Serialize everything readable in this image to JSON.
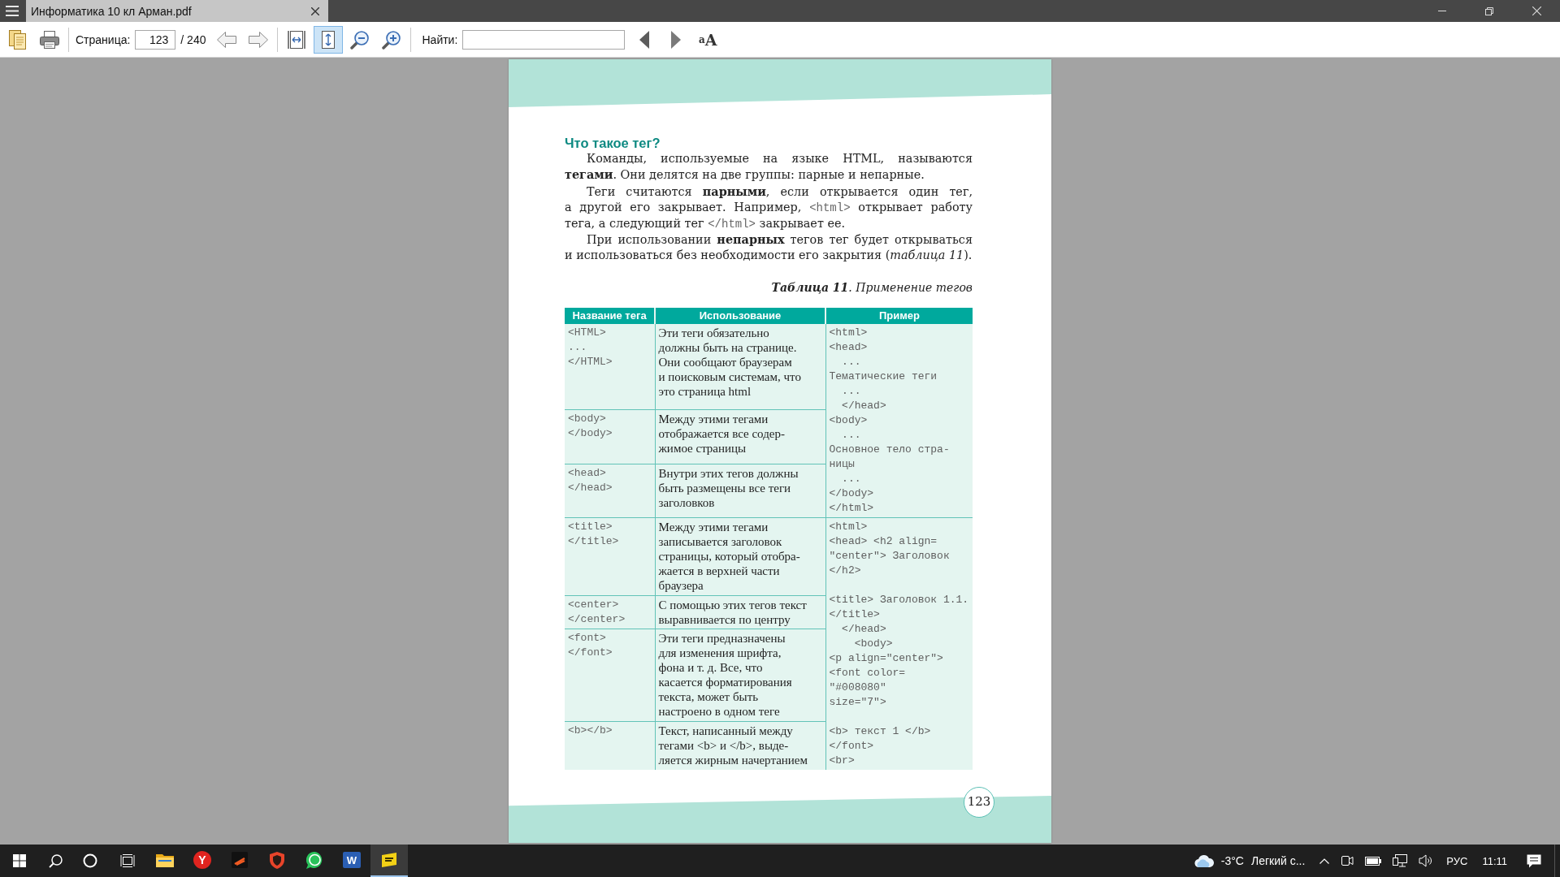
{
  "window": {
    "tab_title": "Информатика 10 кл Арман.pdf"
  },
  "toolbar": {
    "page_label": "Страница:",
    "page_value": "123",
    "page_total": "/ 240",
    "view_modes": [
      {
        "kind": "fit_width",
        "selected": false
      },
      {
        "kind": "fit_page",
        "selected": true
      }
    ],
    "find_label": "Найти:",
    "match_case_label": "$^{a}$A"
  },
  "page": {
    "heading": "Что такое тег?",
    "paragraphs": [
      {
        "segments": [
          {
            "kind": "text",
            "text": "Команды, используемые на языке HTML, называются\n**тегами**. Они делятся на две группы: парные и непарные."
          }
        ]
      },
      {
        "segments": [
          {
            "kind": "text",
            "text": "Теги считаются **парными**, если открывается один тег,\nа другой его закрывает. Например, "
          },
          {
            "kind": "code",
            "text": "<html>"
          },
          {
            "kind": "text",
            "text": " открывает работу\nтега, а следующий тег "
          },
          {
            "kind": "code",
            "text": "</html>"
          },
          {
            "kind": "text",
            "text": " закрывает ее."
          }
        ]
      },
      {
        "segments": [
          {
            "kind": "text",
            "text": "При использовании **непарных** тегов тег будет открываться\nи использоваться без необходимости его закрытия (*таблица 11*)."
          }
        ]
      }
    ],
    "caption": "**Таблица 11**. Применение тегов",
    "table": {
      "columns": [
        "Название тега",
        "Использование",
        "Пример"
      ],
      "groups": [
        {
          "rows": [
            {
              "tag": "<HTML>\n...\n</HTML>",
              "usage": "Эти теги обязательно\nдолжны быть на странице.\nОни сообщают браузерам\nи поисковым системам, что\nэто страница html"
            },
            {
              "tag": "<body>\n</body>",
              "usage": "Между этими тегами\nотображается все содер-\nжимое страницы"
            },
            {
              "tag": "<head>\n</head>",
              "usage": "Внутри этих тегов должны\nбыть размещены все теги\nзаголовков"
            }
          ],
          "example": "<html>\n<head>\n  ...\nТематические теги\n  ...\n  </head>\n<body>\n  ...\nОсновное тело стра-\nницы\n  ...\n</body>\n</html>"
        },
        {
          "rows": [
            {
              "tag": "<title>\n</title>",
              "usage": "Между этими тегами\nзаписывается заголовок\nстраницы, который отобра-\nжается в верхней части\nбраузера"
            },
            {
              "tag": "<center>\n</center>",
              "usage": "С помощью этих тегов текст\nвыравнивается по центру"
            },
            {
              "tag": "<font>\n</font>",
              "usage": "Эти теги предназначены\nдля изменения шрифта,\nфона и т. д. Все, что\nкасается форматирования\nтекста, может быть\nнастроено в одном теге"
            },
            {
              "tag": "<b></b>",
              "usage": "Текст, написанный между\nтегами <b> и </b>, выде-\nляется жирным начертанием"
            }
          ],
          "example": "<html>\n<head> <h2 align=\n\"center\"> Заголовок\n</h2>\n\n<title> Заголовок 1.1.\n</title>\n  </head>\n    <body>\n<p align=\"center\">\n<font color=\n\"#008080\"\nsize=\"7\">\n\n<b> текст 1 </b>\n</font>\n<br>"
        }
      ]
    },
    "page_number": "123"
  },
  "taskbar": {
    "apps": [
      {
        "kind": "folder",
        "active": false
      },
      {
        "kind": "letter_disc",
        "label": "Y",
        "active": false
      },
      {
        "kind": "striped_tile",
        "active": false
      },
      {
        "kind": "shield",
        "active": false
      },
      {
        "kind": "chat",
        "active": false
      },
      {
        "kind": "letter_tile",
        "label": "W",
        "active": false
      },
      {
        "kind": "reader",
        "active": true
      }
    ],
    "temperature": "-3°C",
    "weather": "Легкий с...",
    "language": "РУС",
    "time": "11:11"
  }
}
